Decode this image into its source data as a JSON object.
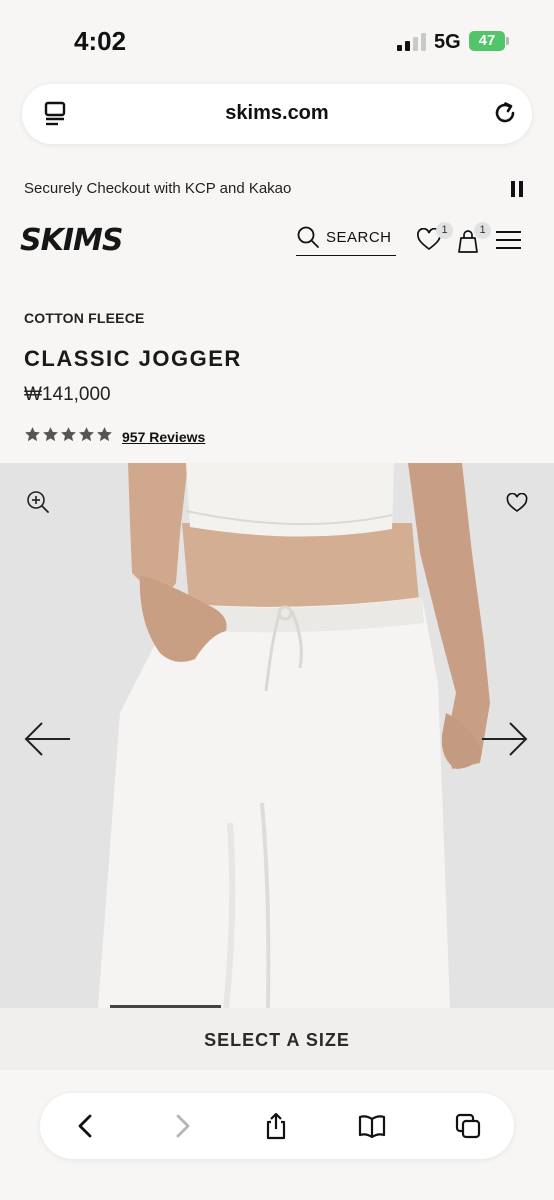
{
  "status_bar": {
    "time": "4:02",
    "network": "5G",
    "battery": "47"
  },
  "browser": {
    "url": "skims.com"
  },
  "promo": {
    "text": "Securely Checkout with KCP and Kakao"
  },
  "header": {
    "logo": "SKIMS",
    "search_label": "SEARCH",
    "wishlist_count": "1",
    "bag_count": "1"
  },
  "product": {
    "collection": "COTTON FLEECE",
    "name": "CLASSIC JOGGER",
    "price": "₩141,000",
    "rating": 5,
    "reviews": "957 Reviews"
  },
  "gallery": {
    "progress_fraction": 0.2
  },
  "size_selector": {
    "label": "SELECT A SIZE"
  },
  "colors": {
    "page_bg": "#f7f6f4",
    "image_bg": "#e4e3e3",
    "battery": "#52c46a",
    "star": "#555555"
  },
  "icons": [
    "tabs-icon",
    "reload-icon",
    "pause-icon",
    "search-icon",
    "heart-icon",
    "bag-icon",
    "menu-icon",
    "zoom-in-icon",
    "arrow-left-icon",
    "arrow-right-icon",
    "back-icon",
    "forward-icon",
    "share-icon",
    "bookmarks-icon",
    "tabs-overview-icon"
  ]
}
